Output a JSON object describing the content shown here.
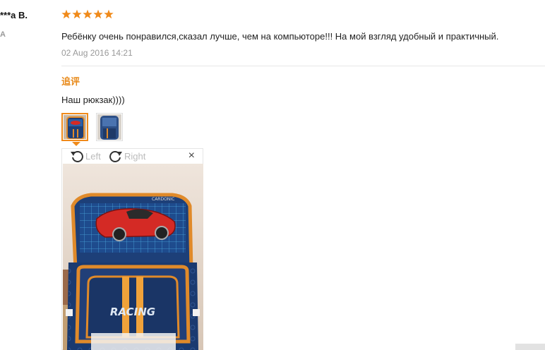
{
  "review": {
    "author": "***a B.",
    "country": "A",
    "rating": 5,
    "text": "Ребёнку очень понравился,сказал лучше, чем на компьютоpe!!! На мой взгляд удобный и практичный.",
    "date": "02 Aug 2016 14:21"
  },
  "followup": {
    "label": "追评",
    "text": "Наш рюкзак))))"
  },
  "viewer": {
    "rotate_left_label": "Left",
    "rotate_right_label": "Right",
    "close_label": "×",
    "photo_texts": {
      "brand": "CARDONIC",
      "racing": "RACING"
    }
  },
  "colors": {
    "star": "#f08a1a",
    "accent": "#e88a1a",
    "backpack_blue": "#1d3f78",
    "backpack_orange": "#e08a2a",
    "car_red": "#d42a25"
  }
}
